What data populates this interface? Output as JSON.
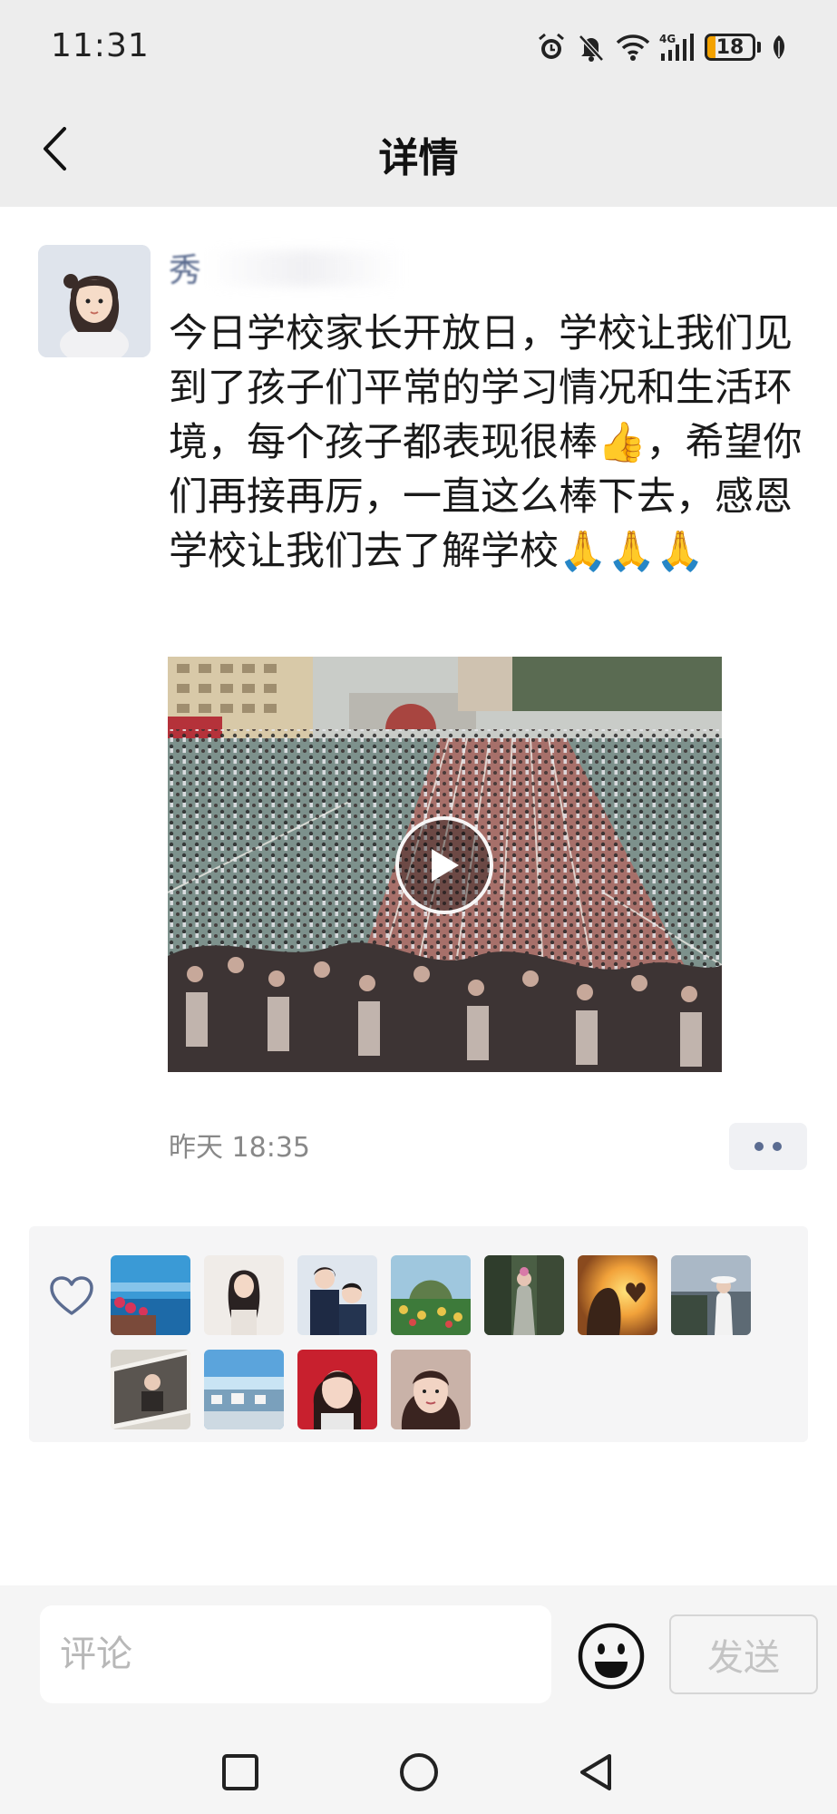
{
  "status_bar": {
    "time": "11:31",
    "battery_level": "18",
    "network": "4G"
  },
  "nav": {
    "title": "详情"
  },
  "post": {
    "username": "秀",
    "text": "今日学校家长开放日，学校让我们见到了孩子们平常的学习情况和生活环境，每个孩子都表现很棒👍，希望你们再接再厉，一直这么棒下去，感恩学校让我们去了解学校🙏🙏🙏",
    "time": "昨天 18:35"
  },
  "likes": {
    "count": 11
  },
  "comment_bar": {
    "placeholder": "评论",
    "send_label": "发送"
  },
  "colors": {
    "link_blue": "#56678c",
    "nav_bg": "#ededed",
    "panel_bg": "#f5f5f6"
  }
}
